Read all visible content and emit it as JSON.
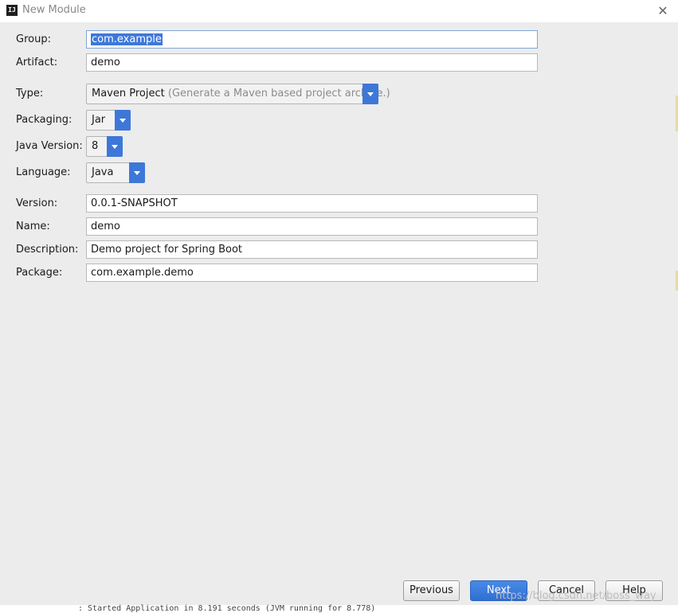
{
  "window": {
    "title": "New Module",
    "app_icon": "IJ",
    "close_icon": "close-icon"
  },
  "form": {
    "group": {
      "label": "Group:",
      "value": "com.example"
    },
    "artifact": {
      "label": "Artifact:",
      "value": "demo"
    },
    "type": {
      "label": "Type:",
      "value": "Maven Project",
      "hint": "(Generate a Maven based project archive.)"
    },
    "packaging": {
      "label": "Packaging:",
      "value": "Jar"
    },
    "java_version": {
      "label": "Java Version:",
      "value": "8"
    },
    "language": {
      "label": "Language:",
      "value": "Java"
    },
    "version": {
      "label": "Version:",
      "value": "0.0.1-SNAPSHOT"
    },
    "name": {
      "label": "Name:",
      "value": "demo"
    },
    "description": {
      "label": "Description:",
      "value": "Demo project for Spring Boot"
    },
    "package": {
      "label": "Package:",
      "value": "com.example.demo"
    }
  },
  "buttons": {
    "previous": "Previous",
    "next": "Next",
    "cancel": "Cancel",
    "help": "Help"
  },
  "watermark": "https://blog.csdn.net/boss_way",
  "background_text": ": Started Application in 8.191 seconds (JVM running for 8.778)",
  "colors": {
    "accent": "#3d78d9",
    "background": "#ececec"
  }
}
